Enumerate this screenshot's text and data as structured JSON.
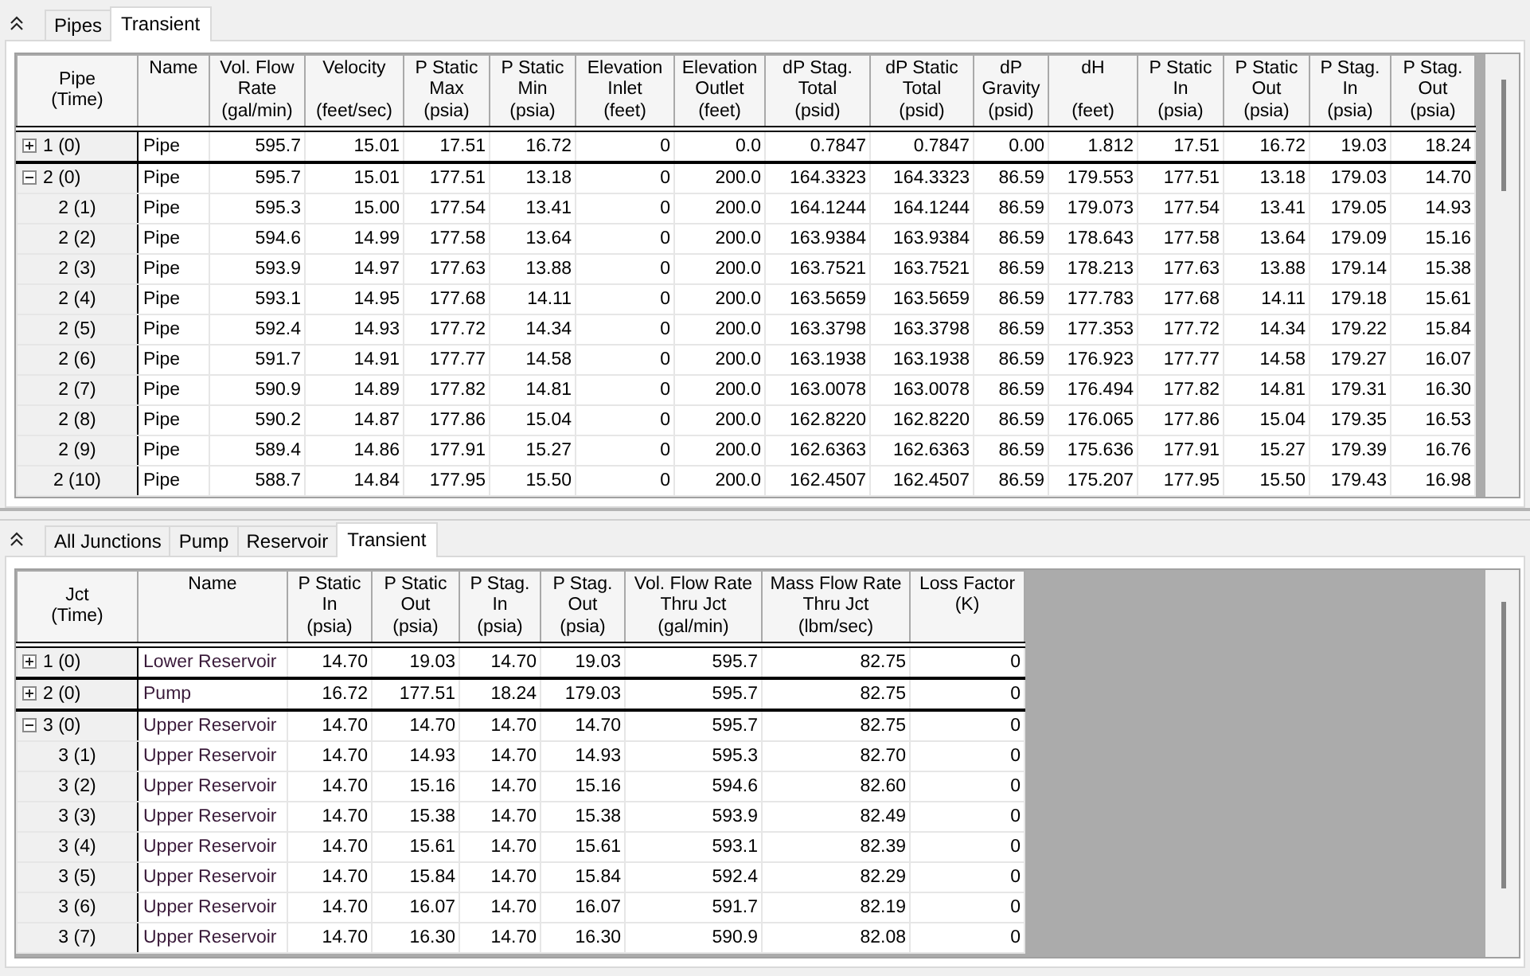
{
  "pipes_panel": {
    "tabs": [
      {
        "label": "Pipes",
        "selected": false
      },
      {
        "label": "Transient",
        "selected": true
      }
    ],
    "table": {
      "stub_header": [
        "Pipe",
        "(Time)"
      ],
      "columns": [
        {
          "title": [
            "Name"
          ]
        },
        {
          "title": [
            "Vol. Flow",
            "Rate"
          ],
          "units": "(gal/min)"
        },
        {
          "title": [
            "Velocity"
          ],
          "units": "(feet/sec)"
        },
        {
          "title": [
            "P Static",
            "Max"
          ],
          "units": "(psia)"
        },
        {
          "title": [
            "P Static",
            "Min"
          ],
          "units": "(psia)"
        },
        {
          "title": [
            "Elevation",
            "Inlet"
          ],
          "units": "(feet)"
        },
        {
          "title": [
            "Elevation",
            "Outlet"
          ],
          "units": "(feet)"
        },
        {
          "title": [
            "dP Stag.",
            "Total"
          ],
          "units": "(psid)"
        },
        {
          "title": [
            "dP Static",
            "Total"
          ],
          "units": "(psid)"
        },
        {
          "title": [
            "dP",
            "Gravity"
          ],
          "units": "(psid)"
        },
        {
          "title": [
            "dH"
          ],
          "units": "(feet)"
        },
        {
          "title": [
            "P Static",
            "In"
          ],
          "units": "(psia)"
        },
        {
          "title": [
            "P Static",
            "Out"
          ],
          "units": "(psia)"
        },
        {
          "title": [
            "P Stag.",
            "In"
          ],
          "units": "(psia)"
        },
        {
          "title": [
            "P Stag.",
            "Out"
          ],
          "units": "(psia)"
        }
      ],
      "rows": [
        {
          "label": "1 (0)",
          "expanded": false,
          "cells": [
            "Pipe",
            "595.7",
            "15.01",
            "17.51",
            "16.72",
            "0",
            "0.0",
            "0.7847",
            "0.7847",
            "0.00",
            "1.812",
            "17.51",
            "16.72",
            "19.03",
            "18.24"
          ]
        },
        {
          "label": "2 (0)",
          "expanded": true,
          "cells": [
            "Pipe",
            "595.7",
            "15.01",
            "177.51",
            "13.18",
            "0",
            "200.0",
            "164.3323",
            "164.3323",
            "86.59",
            "179.553",
            "177.51",
            "13.18",
            "179.03",
            "14.70"
          ],
          "children": [
            {
              "label": "2 (1)",
              "cells": [
                "Pipe",
                "595.3",
                "15.00",
                "177.54",
                "13.41",
                "0",
                "200.0",
                "164.1244",
                "164.1244",
                "86.59",
                "179.073",
                "177.54",
                "13.41",
                "179.05",
                "14.93"
              ]
            },
            {
              "label": "2 (2)",
              "cells": [
                "Pipe",
                "594.6",
                "14.99",
                "177.58",
                "13.64",
                "0",
                "200.0",
                "163.9384",
                "163.9384",
                "86.59",
                "178.643",
                "177.58",
                "13.64",
                "179.09",
                "15.16"
              ]
            },
            {
              "label": "2 (3)",
              "cells": [
                "Pipe",
                "593.9",
                "14.97",
                "177.63",
                "13.88",
                "0",
                "200.0",
                "163.7521",
                "163.7521",
                "86.59",
                "178.213",
                "177.63",
                "13.88",
                "179.14",
                "15.38"
              ]
            },
            {
              "label": "2 (4)",
              "cells": [
                "Pipe",
                "593.1",
                "14.95",
                "177.68",
                "14.11",
                "0",
                "200.0",
                "163.5659",
                "163.5659",
                "86.59",
                "177.783",
                "177.68",
                "14.11",
                "179.18",
                "15.61"
              ]
            },
            {
              "label": "2 (5)",
              "cells": [
                "Pipe",
                "592.4",
                "14.93",
                "177.72",
                "14.34",
                "0",
                "200.0",
                "163.3798",
                "163.3798",
                "86.59",
                "177.353",
                "177.72",
                "14.34",
                "179.22",
                "15.84"
              ]
            },
            {
              "label": "2 (6)",
              "cells": [
                "Pipe",
                "591.7",
                "14.91",
                "177.77",
                "14.58",
                "0",
                "200.0",
                "163.1938",
                "163.1938",
                "86.59",
                "176.923",
                "177.77",
                "14.58",
                "179.27",
                "16.07"
              ]
            },
            {
              "label": "2 (7)",
              "cells": [
                "Pipe",
                "590.9",
                "14.89",
                "177.82",
                "14.81",
                "0",
                "200.0",
                "163.0078",
                "163.0078",
                "86.59",
                "176.494",
                "177.82",
                "14.81",
                "179.31",
                "16.30"
              ]
            },
            {
              "label": "2 (8)",
              "cells": [
                "Pipe",
                "590.2",
                "14.87",
                "177.86",
                "15.04",
                "0",
                "200.0",
                "162.8220",
                "162.8220",
                "86.59",
                "176.065",
                "177.86",
                "15.04",
                "179.35",
                "16.53"
              ]
            },
            {
              "label": "2 (9)",
              "cells": [
                "Pipe",
                "589.4",
                "14.86",
                "177.91",
                "15.27",
                "0",
                "200.0",
                "162.6363",
                "162.6363",
                "86.59",
                "175.636",
                "177.91",
                "15.27",
                "179.39",
                "16.76"
              ]
            },
            {
              "label": "2 (10)",
              "cells": [
                "Pipe",
                "588.7",
                "14.84",
                "177.95",
                "15.50",
                "0",
                "200.0",
                "162.4507",
                "162.4507",
                "86.59",
                "175.207",
                "177.95",
                "15.50",
                "179.43",
                "16.98"
              ]
            }
          ]
        }
      ]
    }
  },
  "junctions_panel": {
    "tabs": [
      {
        "label": "All Junctions",
        "selected": false
      },
      {
        "label": "Pump",
        "selected": false
      },
      {
        "label": "Reservoir",
        "selected": false
      },
      {
        "label": "Transient",
        "selected": true
      }
    ],
    "table": {
      "stub_header": [
        "Jct",
        "(Time)"
      ],
      "columns": [
        {
          "title": [
            "Name"
          ]
        },
        {
          "title": [
            "P Static",
            "In"
          ],
          "units": "(psia)"
        },
        {
          "title": [
            "P Static",
            "Out"
          ],
          "units": "(psia)"
        },
        {
          "title": [
            "P Stag.",
            "In"
          ],
          "units": "(psia)"
        },
        {
          "title": [
            "P Stag.",
            "Out"
          ],
          "units": "(psia)"
        },
        {
          "title": [
            "Vol. Flow Rate",
            "Thru Jct"
          ],
          "units": "(gal/min)"
        },
        {
          "title": [
            "Mass Flow Rate",
            "Thru Jct"
          ],
          "units": "(lbm/sec)"
        },
        {
          "title": [
            "Loss Factor",
            "(K)"
          ]
        }
      ],
      "rows": [
        {
          "label": "1 (0)",
          "expanded": false,
          "cells": [
            "Lower Reservoir",
            "14.70",
            "19.03",
            "14.70",
            "19.03",
            "595.7",
            "82.75",
            "0"
          ]
        },
        {
          "label": "2 (0)",
          "expanded": false,
          "cells": [
            "Pump",
            "16.72",
            "177.51",
            "18.24",
            "179.03",
            "595.7",
            "82.75",
            "0"
          ]
        },
        {
          "label": "3 (0)",
          "expanded": true,
          "cells": [
            "Upper Reservoir",
            "14.70",
            "14.70",
            "14.70",
            "14.70",
            "595.7",
            "82.75",
            "0"
          ],
          "children": [
            {
              "label": "3 (1)",
              "cells": [
                "Upper Reservoir",
                "14.70",
                "14.93",
                "14.70",
                "14.93",
                "595.3",
                "82.70",
                "0"
              ]
            },
            {
              "label": "3 (2)",
              "cells": [
                "Upper Reservoir",
                "14.70",
                "15.16",
                "14.70",
                "15.16",
                "594.6",
                "82.60",
                "0"
              ]
            },
            {
              "label": "3 (3)",
              "cells": [
                "Upper Reservoir",
                "14.70",
                "15.38",
                "14.70",
                "15.38",
                "593.9",
                "82.49",
                "0"
              ]
            },
            {
              "label": "3 (4)",
              "cells": [
                "Upper Reservoir",
                "14.70",
                "15.61",
                "14.70",
                "15.61",
                "593.1",
                "82.39",
                "0"
              ]
            },
            {
              "label": "3 (5)",
              "cells": [
                "Upper Reservoir",
                "14.70",
                "15.84",
                "14.70",
                "15.84",
                "592.4",
                "82.29",
                "0"
              ]
            },
            {
              "label": "3 (6)",
              "cells": [
                "Upper Reservoir",
                "14.70",
                "16.07",
                "14.70",
                "16.07",
                "591.7",
                "82.19",
                "0"
              ]
            },
            {
              "label": "3 (7)",
              "cells": [
                "Upper Reservoir",
                "14.70",
                "16.30",
                "14.70",
                "16.30",
                "590.9",
                "82.08",
                "0"
              ]
            }
          ]
        }
      ]
    }
  }
}
